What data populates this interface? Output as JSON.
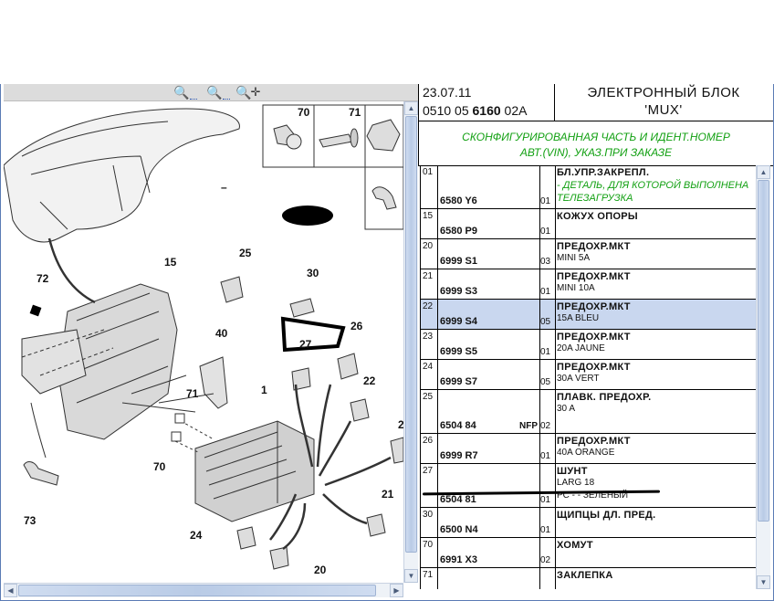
{
  "toolbar": {
    "zoom_in_icon": "zoom-in-icon",
    "zoom_out_icon": "zoom-out-icon",
    "zoom_pan_icon": "zoom-pan-icon"
  },
  "diagram": {
    "callouts": [
      "70",
      "71",
      "15",
      "25",
      "72",
      "30",
      "40",
      "26",
      "27",
      "22",
      "1",
      "71",
      "70",
      "2",
      "73",
      "21",
      "24",
      "20"
    ],
    "inset_dash": "–"
  },
  "header": {
    "date": "23.07.11",
    "ref_prefix": "0510 05",
    "ref_bold": "6160",
    "ref_suffix": "02A",
    "title_line1": "ЭЛЕКТРОННЫЙ БЛОК",
    "title_line2": "'MUX'"
  },
  "note": {
    "line1": "СКОНФИГУРИРОВАННАЯ ЧАСТЬ И ИДЕНТ.НОМЕР",
    "line2": "АВТ.(VIN), УКАЗ.ПРИ ЗАКАЗЕ"
  },
  "rows": [
    {
      "pos": "01",
      "code": "6580 Y6",
      "nfp": "",
      "qty": "01",
      "desc": "БЛ.УПР.ЗАКРЕПЛ.",
      "note1": "- ДЕТАЛЬ, ДЛЯ КОТОРОЙ ВЫПОЛНЕНА ТЕЛЕЗАГРУЗКА",
      "note2": "",
      "selected": false
    },
    {
      "pos": "15",
      "code": "6580 P9",
      "nfp": "",
      "qty": "01",
      "desc": "КОЖУХ ОПОРЫ",
      "note1": "",
      "note2": "",
      "selected": false
    },
    {
      "pos": "20",
      "code": "6999 S1",
      "nfp": "",
      "qty": "03",
      "desc": "ПРЕДОХР.МКТ",
      "note1": "MINI 5A",
      "note2": "",
      "selected": false
    },
    {
      "pos": "21",
      "code": "6999 S3",
      "nfp": "",
      "qty": "01",
      "desc": "ПРЕДОХР.МКТ",
      "note1": "MINI 10A",
      "note2": "",
      "selected": false
    },
    {
      "pos": "22",
      "code": "6999 S4",
      "nfp": "",
      "qty": "05",
      "desc": "ПРЕДОХР.МКТ",
      "note1": "15A BLEU",
      "note2": "",
      "selected": true
    },
    {
      "pos": "23",
      "code": "6999 S5",
      "nfp": "",
      "qty": "01",
      "desc": "ПРЕДОХР.МКТ",
      "note1": "20A JAUNE",
      "note2": "",
      "selected": false
    },
    {
      "pos": "24",
      "code": "6999 S7",
      "nfp": "",
      "qty": "05",
      "desc": "ПРЕДОХР.МКТ",
      "note1": "30A VERT",
      "note2": "",
      "selected": false
    },
    {
      "pos": "25",
      "code": "6504 84",
      "nfp": "NFP",
      "qty": "02",
      "desc": "ПЛАВК. ПРЕДОХР.",
      "note1": "30 A",
      "note2": "",
      "selected": false
    },
    {
      "pos": "26",
      "code": "6999 R7",
      "nfp": "",
      "qty": "01",
      "desc": "ПРЕДОХР.МКТ",
      "note1": "40A ORANGE",
      "note2": "",
      "selected": false
    },
    {
      "pos": "27",
      "code": "6504 81",
      "nfp": "",
      "qty": "01",
      "desc": "ШУНТ",
      "note1": "LARG 18",
      "note2": "PC - - ЗЕЛЕНЫЙ",
      "selected": false
    },
    {
      "pos": "30",
      "code": "6500 N4",
      "nfp": "",
      "qty": "01",
      "desc": "ЩИПЦЫ ДЛ. ПРЕД.",
      "note1": "",
      "note2": "",
      "selected": false
    },
    {
      "pos": "70",
      "code": "6991 X3",
      "nfp": "",
      "qty": "02",
      "desc": "ХОМУТ",
      "note1": "",
      "note2": "",
      "selected": false
    },
    {
      "pos": "71",
      "code": "",
      "nfp": "",
      "qty": "",
      "desc": "ЗАКЛЕПКА",
      "note1": "",
      "note2": "",
      "selected": false
    }
  ],
  "colors": {
    "accent_green": "#12a012",
    "selection": "#c9d7ef",
    "frame": "#5a7bb5"
  }
}
